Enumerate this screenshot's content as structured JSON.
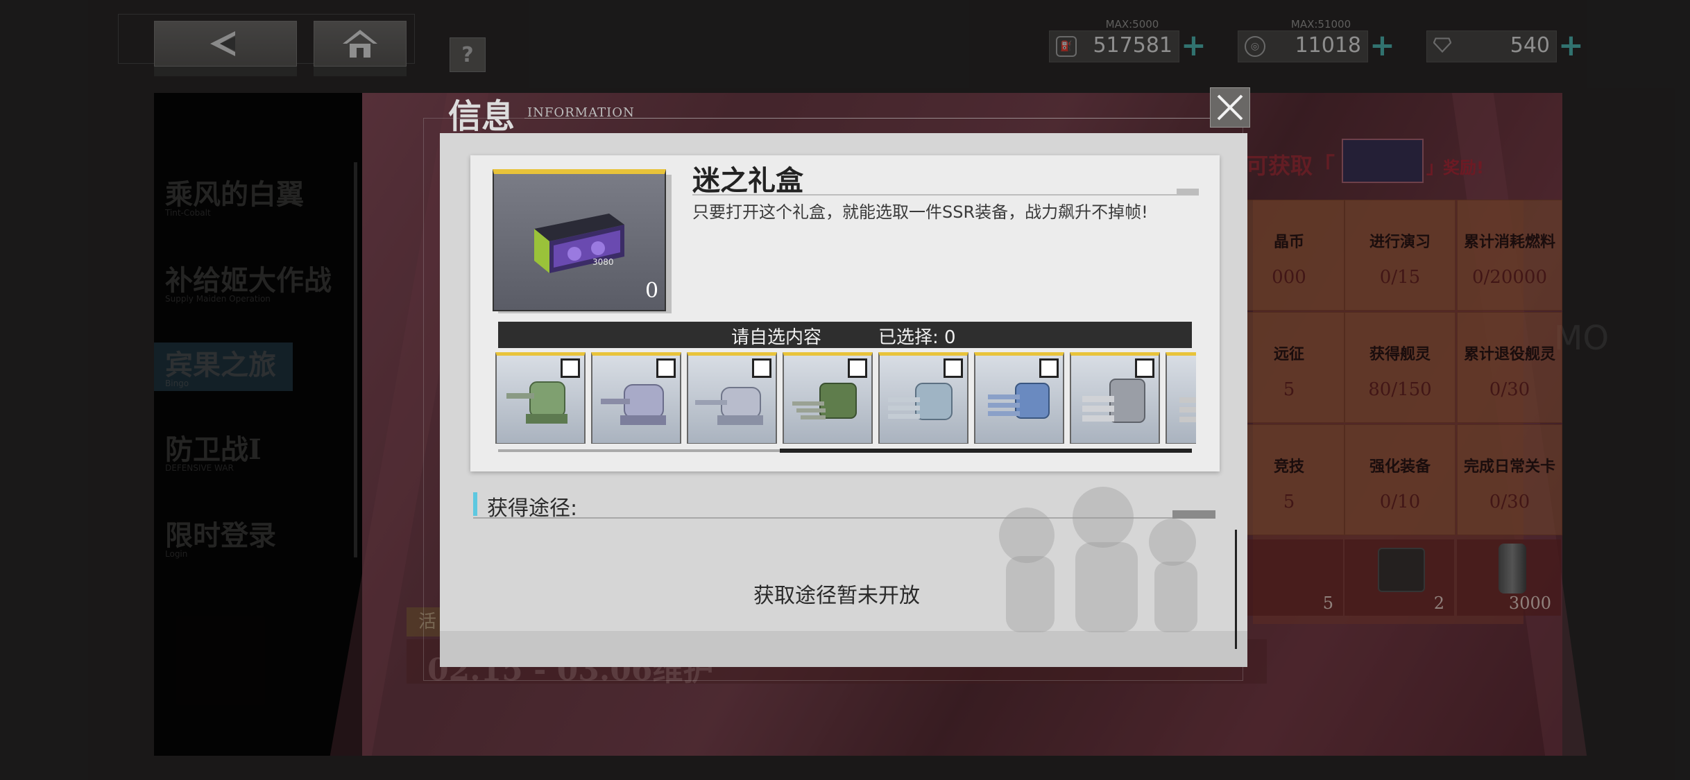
{
  "topbar": {
    "back_icon": "back-arrow-icon",
    "home_icon": "home-icon",
    "help_label": "?",
    "resources": [
      {
        "name": "oil",
        "icon": "oil-icon",
        "max": "MAX:5000",
        "value": "517581",
        "plus": "+"
      },
      {
        "name": "coin",
        "icon": "coin-icon",
        "max": "MAX:51000",
        "value": "11018",
        "plus": "+"
      },
      {
        "name": "gem",
        "icon": "gem-icon",
        "max": "",
        "value": "540",
        "plus": "+"
      }
    ]
  },
  "leftnav": {
    "items": [
      {
        "label": "乘风的白翼",
        "sub": "Tint-Cobalt"
      },
      {
        "label": "补给姬大作战",
        "sub": "Supply Maiden Operation"
      },
      {
        "label": "宾果之旅",
        "sub": "Bingo"
      },
      {
        "label": "防卫战I",
        "sub": "DEFENSIVE WAR"
      },
      {
        "label": "限时登录",
        "sub": "Login"
      }
    ]
  },
  "background": {
    "banner_text": "可获取「",
    "banner_text2": "」奖励!",
    "watermark": "MO",
    "event_tag": "活",
    "date_text": "02.15 - 03.06维护",
    "grid": [
      {
        "title": "晶币",
        "value": "000"
      },
      {
        "title": "进行演习",
        "value": "0/15"
      },
      {
        "title": "累计消耗燃料",
        "value": "0/20000"
      },
      {
        "title": "远征",
        "value": "5"
      },
      {
        "title": "获得舰灵",
        "value": "80/150"
      },
      {
        "title": "累计退役舰灵",
        "value": "0/30"
      },
      {
        "title": "竞技",
        "value": "5"
      },
      {
        "title": "强化装备",
        "value": "0/10"
      },
      {
        "title": "完成日常关卡",
        "value": "0/30"
      }
    ],
    "bottom_counts": [
      "5",
      "2",
      "3000"
    ]
  },
  "dialog": {
    "title": "信息",
    "subtitle": "INFORMATION",
    "close_icon": "close-icon",
    "item": {
      "name": "迷之礼盒",
      "description": "只要打开这个礼盒，就能选取一件SSR装备，战力飙升不掉帧!",
      "count": "0",
      "image": "gift-box-graphics-card"
    },
    "selection": {
      "prompt": "请自选内容",
      "selected": "已选择: 0"
    },
    "equipment": [
      {
        "icon": "turret-green-icon",
        "color": "#7fa070"
      },
      {
        "icon": "turret-lavender-icon",
        "color": "#a8aac8"
      },
      {
        "icon": "turret-silver-icon",
        "color": "#b8bccc"
      },
      {
        "icon": "turret-triple-green-icon",
        "color": "#5f7d4c"
      },
      {
        "icon": "turret-triple-steel-icon",
        "color": "#9fb4c4"
      },
      {
        "icon": "turret-triple-blue-icon",
        "color": "#6a8ac0"
      },
      {
        "icon": "turret-triple-grey-icon",
        "color": "#9a9ea6"
      },
      {
        "icon": "turret-partial-icon",
        "color": "#a4a4a4"
      }
    ],
    "source": {
      "title": "获得途径:",
      "none": "获取途径暂未开放"
    }
  }
}
